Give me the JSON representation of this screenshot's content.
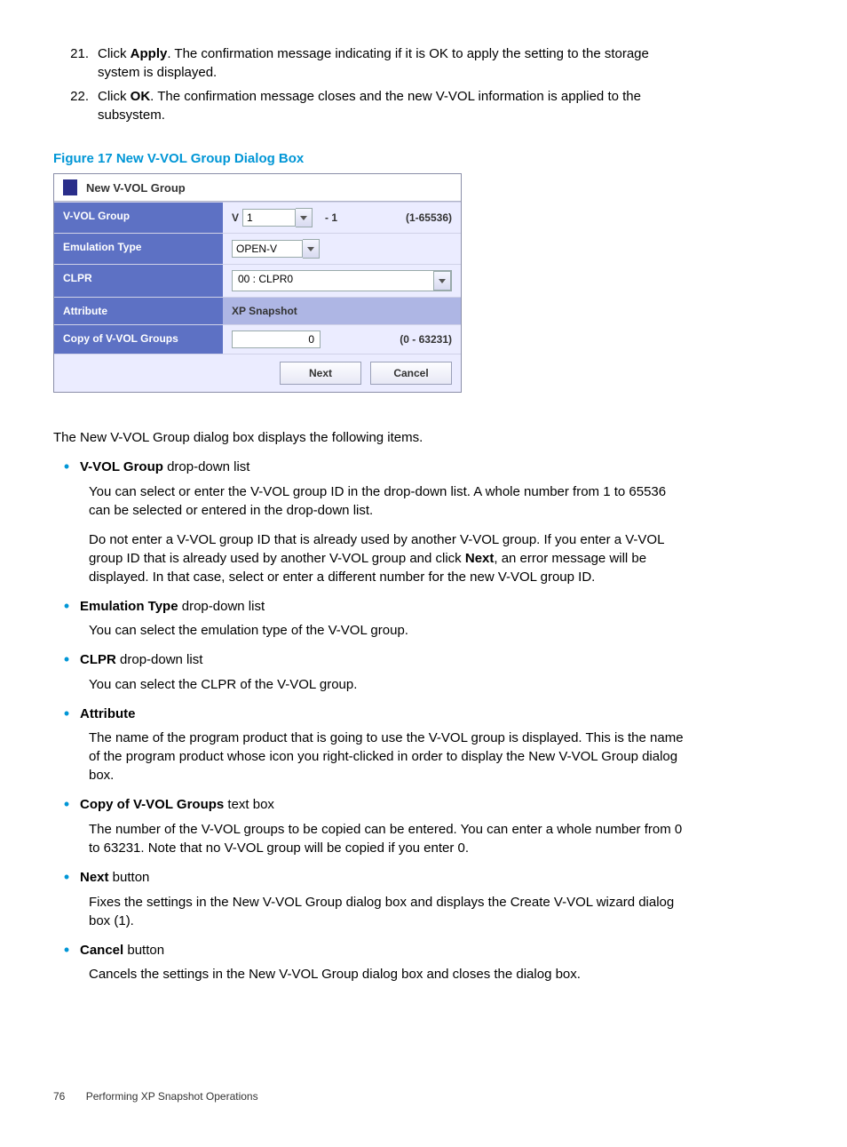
{
  "steps": {
    "s21": {
      "num": "21.",
      "prefix": "Click ",
      "bold": "Apply",
      "rest": ". The confirmation message indicating if it is OK to apply the setting to the storage system is displayed."
    },
    "s22": {
      "num": "22.",
      "prefix": "Click ",
      "bold": "OK",
      "rest": ". The confirmation message closes and the new V-VOL information is applied to the subsystem."
    }
  },
  "fig_caption": "Figure 17 New V-VOL Group Dialog Box",
  "dialog": {
    "title": "New V-VOL Group",
    "rows": {
      "vvol_group": {
        "label": "V-VOL Group",
        "prefix": "V",
        "value": "1",
        "suffix": "- 1",
        "range": "(1-65536)"
      },
      "emulation": {
        "label": "Emulation Type",
        "value": "OPEN-V"
      },
      "clpr": {
        "label": "CLPR",
        "value": "00 : CLPR0"
      },
      "attribute": {
        "label": "Attribute",
        "value": "XP Snapshot"
      },
      "copy": {
        "label": "Copy of V-VOL Groups",
        "value": "0",
        "range": "(0 - 63231)"
      }
    },
    "buttons": {
      "next": "Next",
      "cancel": "Cancel"
    }
  },
  "intro": "The New V-VOL Group dialog box displays the following items.",
  "bullets": {
    "b1": {
      "title": "V-VOL Group",
      "after": " drop-down list",
      "p1": "You can select or enter the V-VOL group ID in the drop-down list. A whole number from 1 to 65536 can be selected or entered in the drop-down list.",
      "p2a": "Do not enter a V-VOL group ID that is already used by another V-VOL group. If you enter a V-VOL group ID that is already used by another V-VOL group and click ",
      "p2bold": "Next",
      "p2c": ", an error message will be displayed. In that case, select or enter a different number for the new V-VOL group ID."
    },
    "b2": {
      "title": "Emulation Type",
      "after": " drop-down list",
      "p1": "You can select the emulation type of the V-VOL group."
    },
    "b3": {
      "title": "CLPR",
      "after": " drop-down list",
      "p1": "You can select the CLPR of the V-VOL group."
    },
    "b4": {
      "title": "Attribute",
      "after": "",
      "p1": "The name of the program product that is going to use the V-VOL group is displayed. This is the name of the program product whose icon you right-clicked in order to display the New V-VOL Group dialog box."
    },
    "b5": {
      "title": "Copy of V-VOL Groups",
      "after": " text box",
      "p1": "The number of the V-VOL groups to be copied can be entered. You can enter a whole number from 0 to 63231. Note that no V-VOL group will be copied if you enter 0."
    },
    "b6": {
      "title": "Next",
      "after": " button",
      "p1": "Fixes the settings in the New V-VOL Group dialog box and displays the Create V-VOL wizard dialog box (1)."
    },
    "b7": {
      "title": "Cancel",
      "after": " button",
      "p1": "Cancels the settings in the New V-VOL Group dialog box and closes the dialog box."
    }
  },
  "footer": {
    "page": "76",
    "chapter": "Performing XP Snapshot Operations"
  }
}
